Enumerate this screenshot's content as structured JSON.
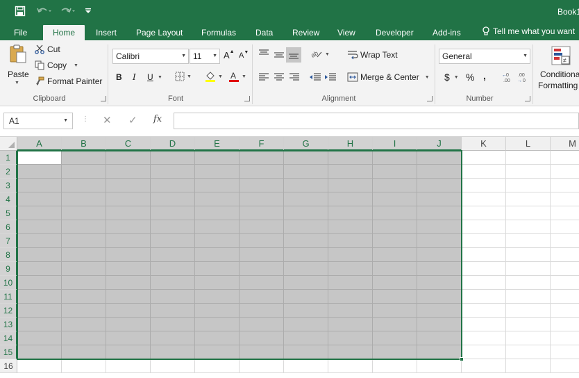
{
  "window": {
    "title": "Book1"
  },
  "ribbon_tabs": [
    "File",
    "Home",
    "Insert",
    "Page Layout",
    "Formulas",
    "Data",
    "Review",
    "View",
    "Developer",
    "Add-ins"
  ],
  "tell_me": "Tell me what you want",
  "clipboard": {
    "paste": "Paste",
    "cut": "Cut",
    "copy": "Copy",
    "format_painter": "Format Painter",
    "group": "Clipboard"
  },
  "font": {
    "name": "Calibri",
    "size": "11",
    "bold": "B",
    "italic": "I",
    "underline": "U",
    "group": "Font"
  },
  "alignment": {
    "wrap_text": "Wrap Text",
    "merge_center": "Merge & Center",
    "group": "Alignment"
  },
  "number": {
    "format": "General",
    "currency": "$",
    "percent": "%",
    "comma": ",",
    "group": "Number"
  },
  "styles": {
    "conditional_line1": "Conditional",
    "conditional_line2": "Formatting"
  },
  "formula_bar": {
    "name_box": "A1",
    "fx": "fx",
    "value": ""
  },
  "sheet": {
    "columns": [
      "A",
      "B",
      "C",
      "D",
      "E",
      "F",
      "G",
      "H",
      "I",
      "J",
      "K",
      "L",
      "M"
    ],
    "rows": [
      "1",
      "2",
      "3",
      "4",
      "5",
      "6",
      "7",
      "8",
      "9",
      "10",
      "11",
      "12",
      "13",
      "14",
      "15",
      "16"
    ],
    "selection": "A1:J15",
    "active_cell": "A1"
  },
  "colors": {
    "accent": "#217346",
    "selection_fill": "#c6c6c6"
  }
}
